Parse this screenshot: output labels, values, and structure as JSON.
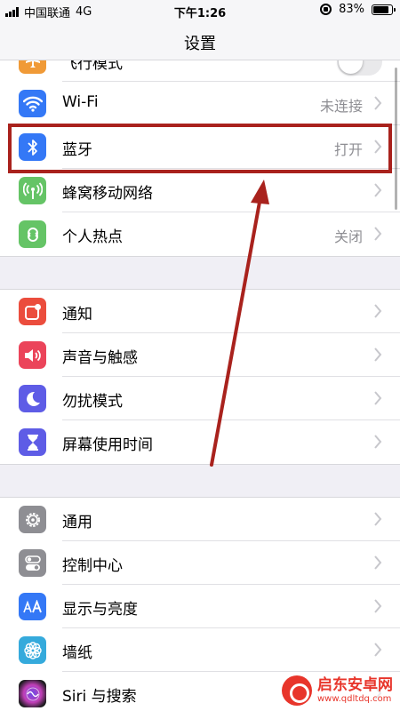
{
  "status": {
    "carrier": "中国联通",
    "network": "4G",
    "time": "下午1:26",
    "battery": "83%",
    "battery_level": 0.83
  },
  "header": {
    "title": "设置"
  },
  "groups": {
    "connectivity": [
      {
        "name": "airplane-mode",
        "label": "飞行模式",
        "icon": "airplane-icon",
        "color": "#f09a37",
        "toggle": false
      },
      {
        "name": "wifi",
        "label": "Wi-Fi",
        "value": "未连接",
        "icon": "wifi-icon",
        "color": "#3478f6"
      },
      {
        "name": "bluetooth",
        "label": "蓝牙",
        "value": "打开",
        "icon": "bluetooth-icon",
        "color": "#3478f6"
      },
      {
        "name": "cellular",
        "label": "蜂窝移动网络",
        "value": "",
        "icon": "antenna-icon",
        "color": "#65c466"
      },
      {
        "name": "hotspot",
        "label": "个人热点",
        "value": "关闭",
        "icon": "hotspot-icon",
        "color": "#65c466"
      }
    ],
    "notifications": [
      {
        "name": "notifications",
        "label": "通知",
        "icon": "notification-icon",
        "color": "#eb4d3d"
      },
      {
        "name": "sounds",
        "label": "声音与触感",
        "icon": "speaker-icon",
        "color": "#eb445a"
      },
      {
        "name": "do-not-disturb",
        "label": "勿扰模式",
        "icon": "moon-icon",
        "color": "#5e5ce6"
      },
      {
        "name": "screen-time",
        "label": "屏幕使用时间",
        "icon": "hourglass-icon",
        "color": "#5e5ce6"
      }
    ],
    "general": [
      {
        "name": "general",
        "label": "通用",
        "icon": "gear-icon",
        "color": "#8e8e93"
      },
      {
        "name": "control-center",
        "label": "控制中心",
        "icon": "switches-icon",
        "color": "#8e8e93"
      },
      {
        "name": "display",
        "label": "显示与亮度",
        "icon": "text-size-icon",
        "color": "#3478f6"
      },
      {
        "name": "wallpaper",
        "label": "墙纸",
        "icon": "flower-icon",
        "color": "#35aadc"
      },
      {
        "name": "siri",
        "label": "Siri 与搜索",
        "icon": "siri-icon",
        "color": "#1c1c1e"
      }
    ]
  },
  "annotation": {
    "highlight_color": "#a9221d",
    "arrow_color": "#a9221d"
  },
  "watermark": {
    "name": "启东安卓网",
    "url": "www.qdltdq.com"
  }
}
